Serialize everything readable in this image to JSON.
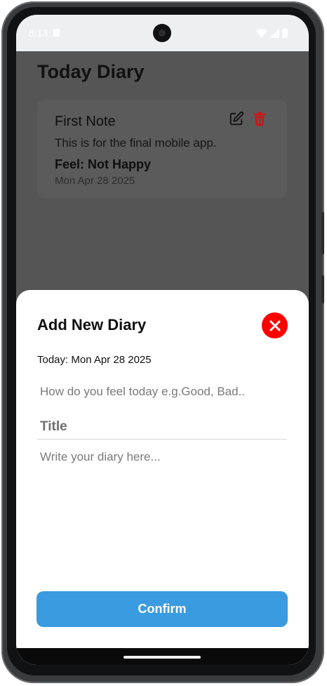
{
  "status_bar": {
    "time": "8:13",
    "icons": [
      "sim-card-icon",
      "wifi-icon",
      "signal-icon",
      "battery-icon"
    ]
  },
  "app": {
    "title": "Today Diary",
    "notes": [
      {
        "title": "First Note",
        "body": "This is for the final mobile app.",
        "feel": "Feel: Not Happy",
        "date": "Mon Apr 28 2025",
        "actions": [
          "edit-icon",
          "delete-icon"
        ]
      }
    ]
  },
  "sheet": {
    "title": "Add New Diary",
    "date_label": "Today: Mon Apr 28 2025",
    "feel_placeholder": "How do you feel today e.g.Good, Bad..",
    "title_placeholder": "Title",
    "diary_placeholder": "Write your diary here...",
    "confirm_label": "Confirm",
    "close_icon": "close-icon"
  },
  "colors": {
    "accent": "#3a9be0",
    "close": "#ff0000",
    "delete": "#c81818",
    "overlay": "#555555"
  }
}
